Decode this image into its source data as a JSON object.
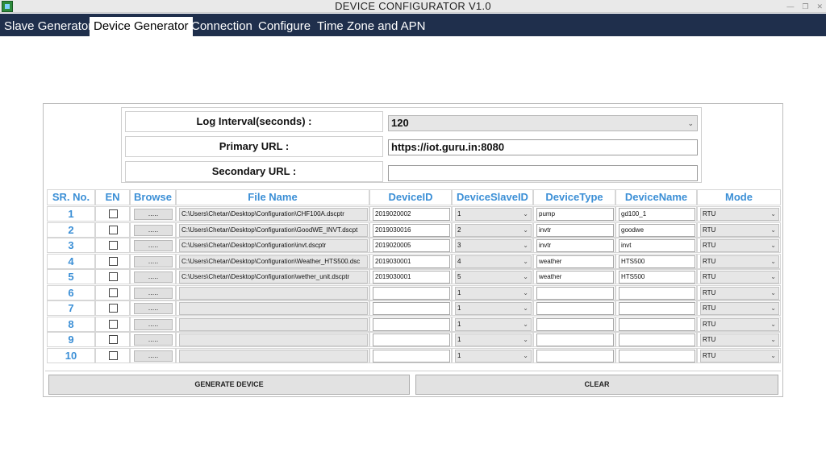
{
  "window": {
    "title": "DEVICE CONFIGURATOR V1.0"
  },
  "menu": [
    {
      "label": "Slave Generator",
      "active": false
    },
    {
      "label": "Device Generator",
      "active": true
    },
    {
      "label": "Connection",
      "active": false
    },
    {
      "label": "Configure",
      "active": false
    },
    {
      "label": "Time Zone and APN",
      "active": false
    }
  ],
  "config": {
    "log_interval_label": "Log Interval(seconds) :",
    "log_interval_value": "120",
    "primary_url_label": "Primary URL :",
    "primary_url_value": "https://iot.guru.in:8080",
    "secondary_url_label": "Secondary URL :",
    "secondary_url_value": ""
  },
  "grid": {
    "headers": [
      "SR. No.",
      "EN",
      "Browse",
      "File Name",
      "DeviceID",
      "DeviceSlaveID",
      "DeviceType",
      "DeviceName",
      "Mode"
    ],
    "browse_label": ".....",
    "rows": [
      {
        "sr": "1",
        "file": "C:\\Users\\Chetan\\Desktop\\Configuration\\CHF100A.dscptr",
        "device_id": "2019020002",
        "slave_id": "1",
        "type": "pump",
        "name": "gd100_1",
        "mode": "RTU"
      },
      {
        "sr": "2",
        "file": "C:\\Users\\Chetan\\Desktop\\Configuration\\GoodWE_INVT.dscpt",
        "device_id": "2019030016",
        "slave_id": "2",
        "type": "invtr",
        "name": "goodwe",
        "mode": "RTU"
      },
      {
        "sr": "3",
        "file": "C:\\Users\\Chetan\\Desktop\\Configuration\\invt.dscptr",
        "device_id": "2019020005",
        "slave_id": "3",
        "type": "invtr",
        "name": "invt",
        "mode": "RTU"
      },
      {
        "sr": "4",
        "file": "C:\\Users\\Chetan\\Desktop\\Configuration\\Weather_HTS500.dsc",
        "device_id": "2019030001",
        "slave_id": "4",
        "type": "weather",
        "name": "HTS500",
        "mode": "RTU"
      },
      {
        "sr": "5",
        "file": "C:\\Users\\Chetan\\Desktop\\Configuration\\wether_unit.dscptr",
        "device_id": "2019030001",
        "slave_id": "5",
        "type": "weather",
        "name": "HTS500",
        "mode": "RTU"
      },
      {
        "sr": "6",
        "file": "",
        "device_id": "",
        "slave_id": "1",
        "type": "",
        "name": "",
        "mode": "RTU"
      },
      {
        "sr": "7",
        "file": "",
        "device_id": "",
        "slave_id": "1",
        "type": "",
        "name": "",
        "mode": "RTU"
      },
      {
        "sr": "8",
        "file": "",
        "device_id": "",
        "slave_id": "1",
        "type": "",
        "name": "",
        "mode": "RTU"
      },
      {
        "sr": "9",
        "file": "",
        "device_id": "",
        "slave_id": "1",
        "type": "",
        "name": "",
        "mode": "RTU"
      },
      {
        "sr": "10",
        "file": "",
        "device_id": "",
        "slave_id": "1",
        "type": "",
        "name": "",
        "mode": "RTU"
      }
    ]
  },
  "buttons": {
    "generate": "GENERATE DEVICE",
    "clear": "CLEAR"
  }
}
